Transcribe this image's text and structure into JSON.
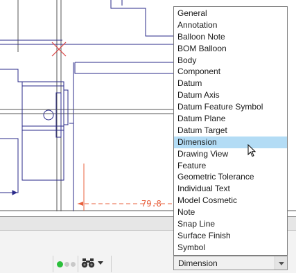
{
  "canvas": {
    "dimension_text": "79.8",
    "line_color": "#2a2a8a",
    "dimension_color": "#e8603c",
    "marker_color": "#d94040"
  },
  "dropdown": {
    "options": [
      "General",
      "Annotation",
      "Balloon Note",
      "BOM Balloon",
      "Body",
      "Component",
      "Datum",
      "Datum Axis",
      "Datum Feature Symbol",
      "Datum Plane",
      "Datum Target",
      "Dimension",
      "Drawing View",
      "Feature",
      "Geometric Tolerance",
      "Individual Text",
      "Model Cosmetic",
      "Note",
      "Snap Line",
      "Surface Finish",
      "Symbol"
    ],
    "highlighted": "Dimension",
    "highlight_color": "#b3dcf5"
  },
  "status_bar": {
    "filter_value": "Dimension",
    "find_icon": "binoculars-icon",
    "status_indicator": "status-dots-icon"
  }
}
